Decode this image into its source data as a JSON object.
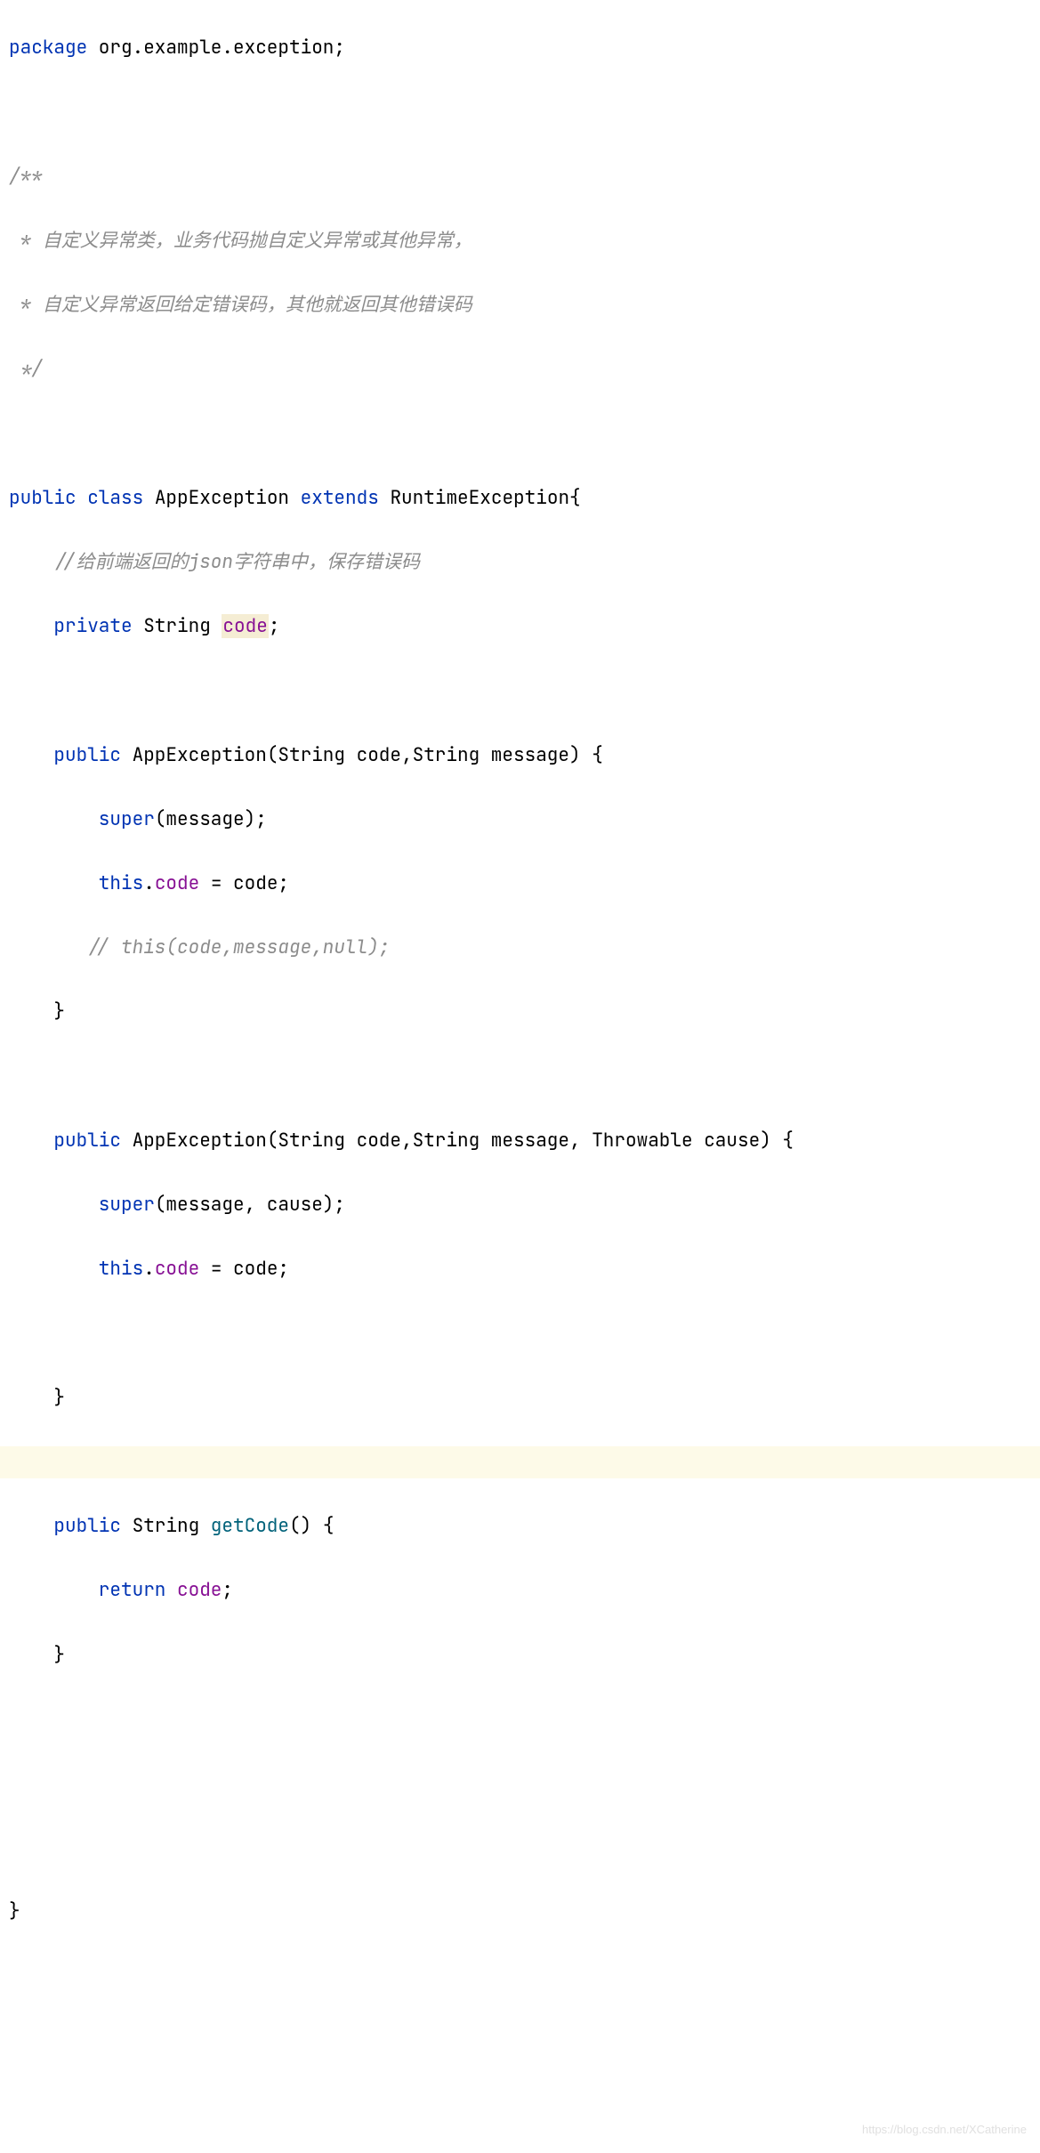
{
  "code": {
    "line1_package": "package",
    "line1_pkg": " org.example.exception;",
    "line3_comment": "/**",
    "line4_comment": " * 自定义异常类，业务代码抛自定义异常或其他异常，",
    "line5_comment": " * 自定义异常返回给定错误码，其他就返回其他错误码",
    "line6_comment": " */",
    "line8_public": "public",
    "line8_class": " class",
    "line8_name": " AppException",
    "line8_extends": " extends",
    "line8_parent": " RuntimeException{",
    "line9_comment": "    //给前端返回的json字符串中，保存错误码",
    "line10_private": "    private",
    "line10_string": " String",
    "line10_code": "code",
    "line10_semi": ";",
    "line12_public": "    public",
    "line12_method": " AppException",
    "line12_params": "(String code,String message) {",
    "line13_super": "        super",
    "line13_args": "(message);",
    "line14_this": "        this",
    "line14_dot": ".",
    "line14_field": "code",
    "line14_assign": " = code;",
    "line15_comment": "       // this(code,message,null);",
    "line16_brace": "    }",
    "line18_public": "    public",
    "line18_method": " AppException",
    "line18_params": "(String code,String message, Throwable cause) {",
    "line19_super": "        super",
    "line19_args": "(message, cause);",
    "line20_this": "        this",
    "line20_dot": ".",
    "line20_field": "code",
    "line20_assign": " = code;",
    "line22_brace": "    }",
    "line24_public": "    public",
    "line24_string": " String",
    "line24_method": " getCode",
    "line24_params": "() {",
    "line25_return": "        return",
    "line25_field": " code",
    "line25_semi": ";",
    "line26_brace": "    }",
    "line30_brace": "}"
  },
  "watermark": "https://blog.csdn.net/XCatherine"
}
